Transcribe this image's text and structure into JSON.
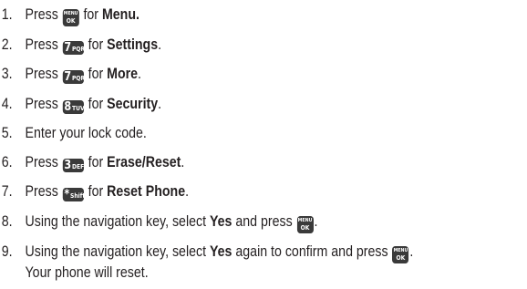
{
  "steps": [
    {
      "number": "1.",
      "before": "Press ",
      "key": "MENU / OK",
      "after": " for ",
      "bold": "Menu.",
      "end": ""
    },
    {
      "number": "2.",
      "before": "Press ",
      "key": "7 PQRS",
      "after": " for ",
      "bold": "Settings",
      "end": "."
    },
    {
      "number": "3.",
      "before": "Press ",
      "key": "7 PQRS",
      "after": " for ",
      "bold": "More",
      "end": "."
    },
    {
      "number": "4.",
      "before": "Press ",
      "key": "8 TUV",
      "after": " for ",
      "bold": "Security",
      "end": "."
    },
    {
      "number": "5.",
      "text": "Enter your lock code."
    },
    {
      "number": "6.",
      "before": "Press ",
      "key": "3 DEF",
      "after": " for ",
      "bold": "Erase/Reset",
      "end": "."
    },
    {
      "number": "7.",
      "before": "Press ",
      "key": "* Shift",
      "after": " for ",
      "bold": "Reset Phone",
      "end": "."
    },
    {
      "number": "8.",
      "before": "Using the navigation key, select ",
      "bold": "Yes",
      "after": " and press ",
      "key": "MENU / OK",
      "end": "."
    },
    {
      "number": "9.",
      "before": "Using the navigation key, select ",
      "bold": "Yes",
      "after": " again to confirm and press ",
      "key": "MENU / OK",
      "end": ".",
      "continuation": "Your phone will reset."
    }
  ],
  "keys": {
    "menu_top": "MENU",
    "menu_bottom": "OK",
    "seven_digit": "7",
    "seven_letters": "PQRS",
    "eight_digit": "8",
    "eight_letters": "TUV",
    "three_digit": "3",
    "three_letters": "DEF",
    "star_digit": "*",
    "star_letters": "Shift"
  },
  "colors": {
    "text": "#231f20",
    "key_background": "#3a3a3a",
    "key_text": "#ffffff"
  }
}
